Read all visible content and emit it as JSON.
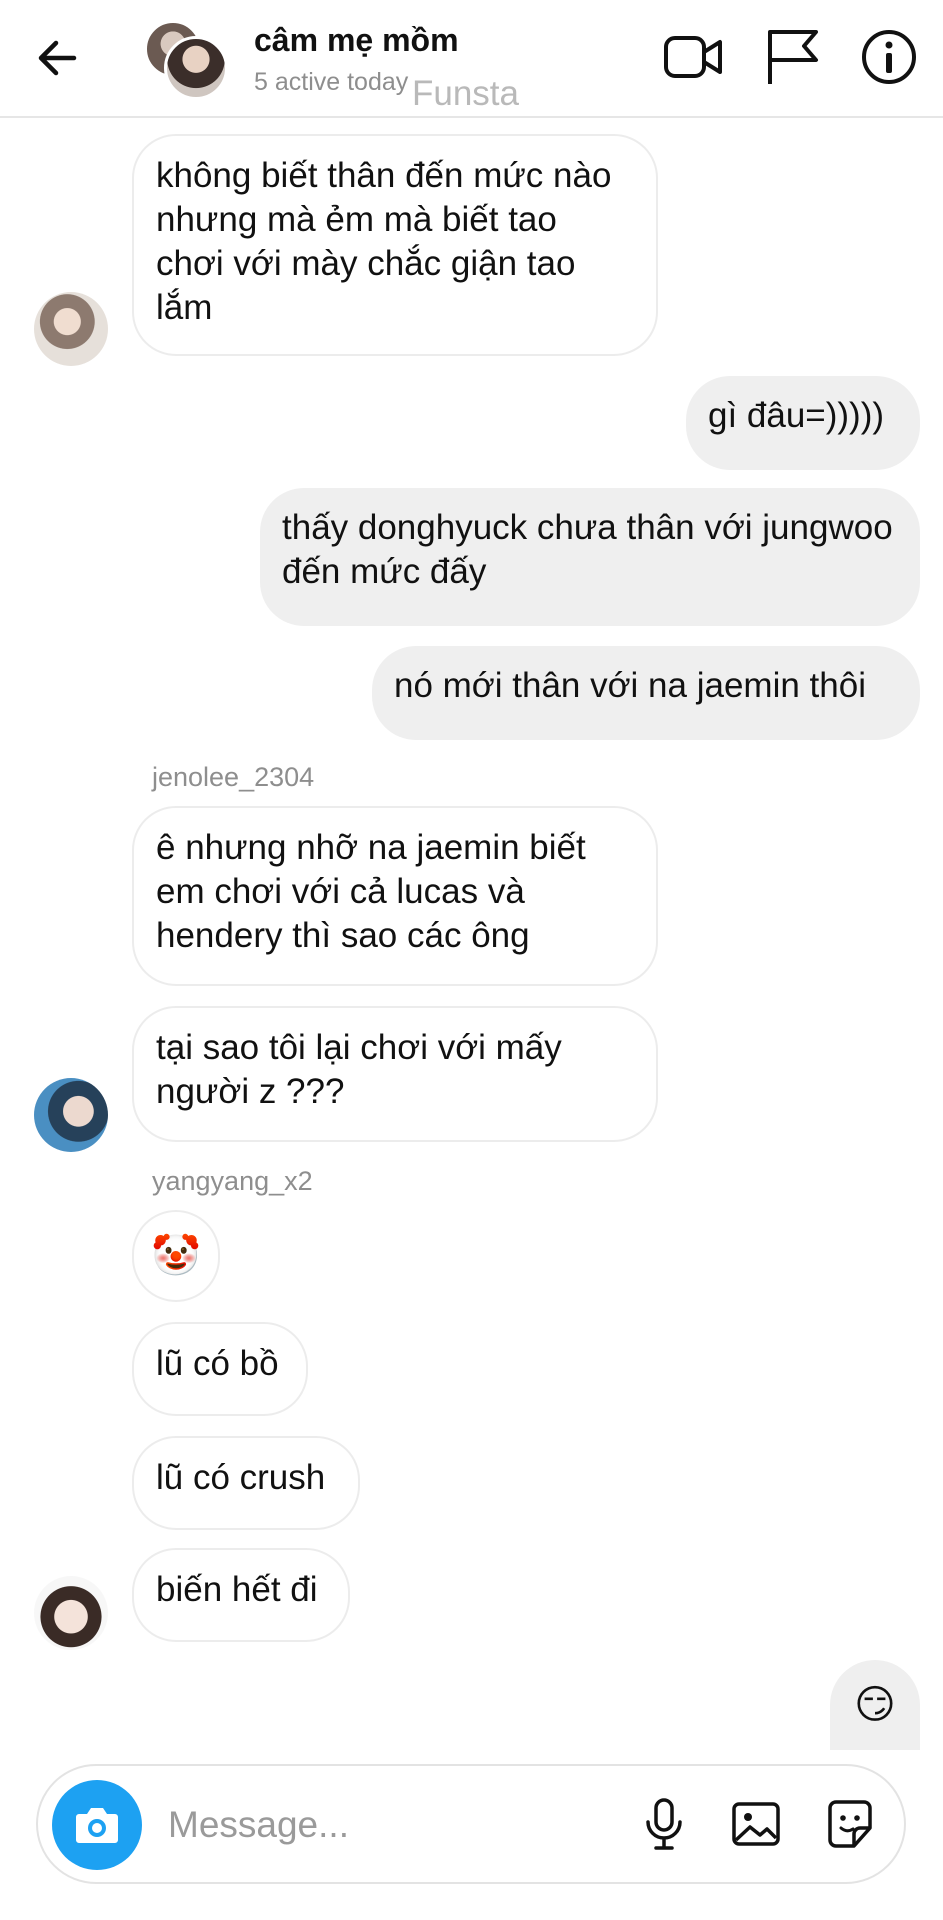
{
  "header": {
    "title": "câm mẹ mồm",
    "status": "5 active today",
    "watermark": "Funsta"
  },
  "messages": [
    {
      "id": "m1",
      "side": "in",
      "text": "không biết thân đến mức nào nhưng mà ẻm mà biết tao chơi với mày chắc giận tao lắm"
    },
    {
      "id": "m2",
      "side": "out",
      "text": "gì đâu=)))))"
    },
    {
      "id": "m3",
      "side": "out",
      "text": "thấy donghyuck chưa thân với jungwoo đến mức đấy"
    },
    {
      "id": "m4",
      "side": "out",
      "text": "nó mới thân với na jaemin thôi"
    },
    {
      "id": "m5",
      "side": "in",
      "sender": "jenolee_2304",
      "text": "ê nhưng nhỡ na jaemin biết em chơi với cả lucas và hendery thì sao các ông"
    },
    {
      "id": "m6",
      "side": "in",
      "text": "tại sao tôi lại chơi với mấy người z ???"
    },
    {
      "id": "m7",
      "side": "in",
      "sender": "yangyang_x2",
      "text": "🤡"
    },
    {
      "id": "m8",
      "side": "in",
      "text": "lũ có bồ"
    },
    {
      "id": "m9",
      "side": "in",
      "text": "lũ có crush"
    },
    {
      "id": "m10",
      "side": "in",
      "text": "biến hết đi"
    },
    {
      "id": "m11",
      "side": "out",
      "text": "😏"
    }
  ],
  "composer": {
    "placeholder": "Message..."
  },
  "icons": {
    "back": "arrow-left-icon",
    "video": "video-camera-icon",
    "flag": "flag-icon",
    "info": "info-icon",
    "camera": "camera-icon",
    "mic": "microphone-icon",
    "gallery": "image-icon",
    "sticker": "sticker-icon"
  },
  "colors": {
    "accent": "#1da1f2",
    "outgoing_bubble": "#efefef",
    "incoming_border": "#ececec",
    "muted_text": "#8e8e8e"
  }
}
